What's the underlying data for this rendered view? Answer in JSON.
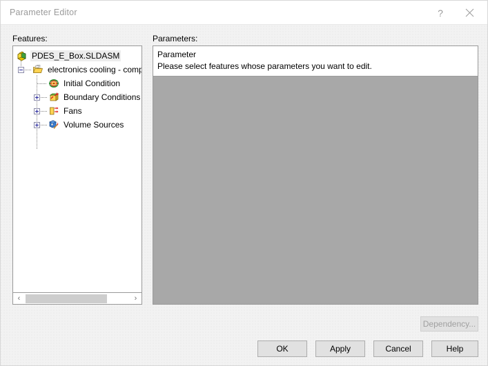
{
  "window": {
    "title": "Parameter Editor",
    "help_icon": "question-mark-icon",
    "close_icon": "close-icon"
  },
  "features": {
    "label": "Features:",
    "tree": [
      {
        "label": "PDES_E_Box.SLDASM",
        "icon": "assembly-icon",
        "depth": 0,
        "expander": "none",
        "selected": true
      },
      {
        "label": "electronics cooling - complete",
        "icon": "project-folder-icon",
        "depth": 1,
        "expander": "minus",
        "selected": false
      },
      {
        "label": "Initial Condition",
        "icon": "initial-condition-icon",
        "depth": 2,
        "expander": "none",
        "selected": false
      },
      {
        "label": "Boundary Conditions",
        "icon": "boundary-conditions-icon",
        "depth": 2,
        "expander": "plus",
        "selected": false
      },
      {
        "label": "Fans",
        "icon": "fans-icon",
        "depth": 2,
        "expander": "plus",
        "selected": false
      },
      {
        "label": "Volume Sources",
        "icon": "volume-sources-icon",
        "depth": 2,
        "expander": "plus",
        "selected": false
      }
    ],
    "scrollbar": {
      "left_arrow": "‹",
      "right_arrow": "›"
    }
  },
  "parameters": {
    "label": "Parameters:",
    "header_title": "Parameter",
    "header_message": "Please select features whose parameters you want to edit."
  },
  "buttons": {
    "dependency": "Dependency...",
    "ok": "OK",
    "apply": "Apply",
    "cancel": "Cancel",
    "help": "Help"
  },
  "colors": {
    "dialog_background": "#f2f2f2",
    "titlebar": "#ffffff",
    "panel_border": "#999999",
    "parameters_body": "#a8a8a8",
    "button_face": "#e1e1e1",
    "selection": "#ededed"
  }
}
